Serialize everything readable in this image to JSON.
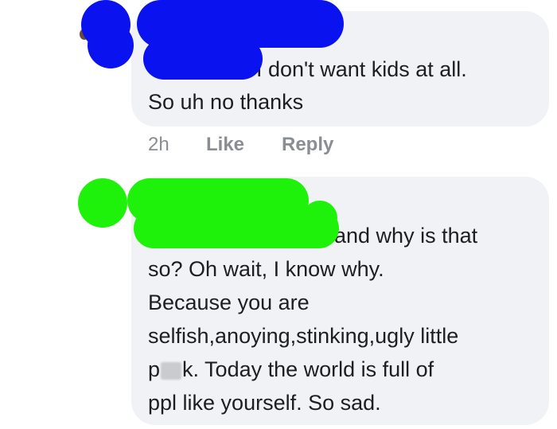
{
  "comment1": {
    "line1": "I don't want kids at all.",
    "line2": "So uh no thanks",
    "time": "2h",
    "like": "Like",
    "reply": "Reply"
  },
  "comment2": {
    "line1": "and why is that",
    "line2": "so? Oh wait, I know why.",
    "line3": "Because you are",
    "line4": "selfish,anoying,stinking,ugly little",
    "line5_start": "p",
    "line5_end": "k. Today the world is full of",
    "line6": "ppl like yourself. So sad."
  },
  "colors": {
    "bubble": "#f0f2f5",
    "text": "#1c1e21",
    "meta": "#8a8d91",
    "redact_blue": "#0a12f0",
    "redact_green": "#1ef20a"
  }
}
